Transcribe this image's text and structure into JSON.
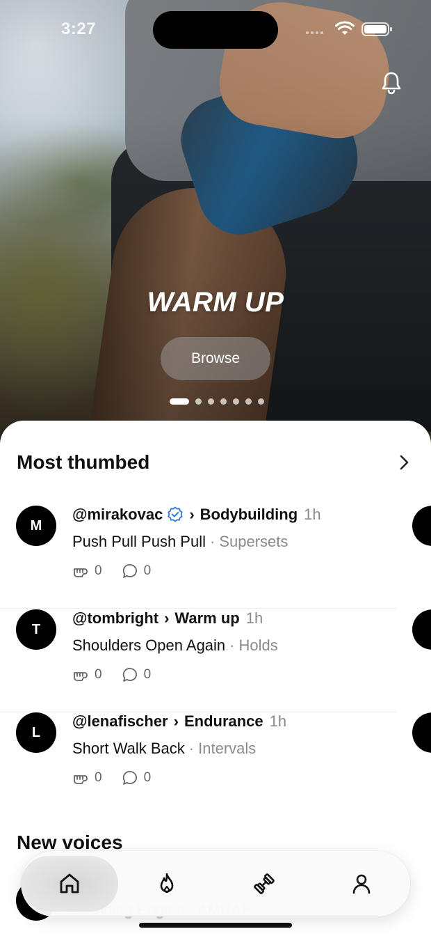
{
  "status_bar": {
    "time": "3:27"
  },
  "hero": {
    "title": "WARM UP",
    "browse_label": "Browse",
    "page_count": 7,
    "active_page": 1
  },
  "most_thumbed": {
    "title": "Most thumbed",
    "items": [
      {
        "avatar_letter": "M",
        "handle": "@mirakovac",
        "verified": true,
        "separator": "›",
        "category": "Bodybuilding",
        "time": "1h",
        "title": "Push Pull Push Pull",
        "dot": "·",
        "type": "Supersets",
        "thumbs": "0",
        "comments": "0"
      },
      {
        "avatar_letter": "T",
        "handle": "@tombright",
        "verified": false,
        "separator": "›",
        "category": "Warm up",
        "time": "1h",
        "title": "Shoulders Open Again",
        "dot": "·",
        "type": "Holds",
        "thumbs": "0",
        "comments": "0"
      },
      {
        "avatar_letter": "L",
        "handle": "@lenafischer",
        "verified": false,
        "separator": "›",
        "category": "Endurance",
        "time": "1h",
        "title": "Short Walk Back",
        "dot": "·",
        "type": "Intervals",
        "thumbs": "0",
        "comments": "0"
      }
    ]
  },
  "new_voices": {
    "title": "New voices",
    "first_item_title": "Standing Engine · AMRAP"
  },
  "tabbar": {
    "tabs": [
      {
        "name": "home",
        "icon": "home-icon",
        "active": true
      },
      {
        "name": "trending",
        "icon": "flame-icon",
        "active": false
      },
      {
        "name": "workouts",
        "icon": "dumbbell-icon",
        "active": false
      },
      {
        "name": "profile",
        "icon": "person-icon",
        "active": false
      }
    ]
  },
  "colors": {
    "accent_verified": "#2f7bd9",
    "text_primary": "#111111",
    "text_secondary": "#8a8a8a"
  }
}
